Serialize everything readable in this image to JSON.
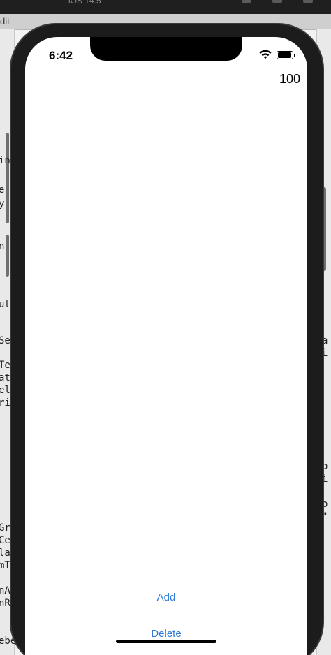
{
  "simulator": {
    "title_fragment": "iOS 14.5",
    "tab_fragment": "dit"
  },
  "background_snippets": [
    "in",
    "e",
    "y",
    "n",
    "ut",
    "Se",
    "Te",
    "at",
    "el",
    "ri",
    "Gr",
    "Ce",
    "la",
    "mT",
    "nA",
    "nR",
    "ebe",
    "a",
    "i",
    "o",
    "i",
    "o",
    "\""
  ],
  "status_bar": {
    "time": "6:42",
    "icons": [
      "wifi-icon",
      "battery-icon"
    ]
  },
  "app": {
    "counter_value": "100",
    "add_label": "Add",
    "delete_label": "Delete"
  },
  "colors": {
    "link": "#2f7bd6",
    "screen_bg": "#ffffff",
    "device_frame": "#1c1c1c"
  }
}
